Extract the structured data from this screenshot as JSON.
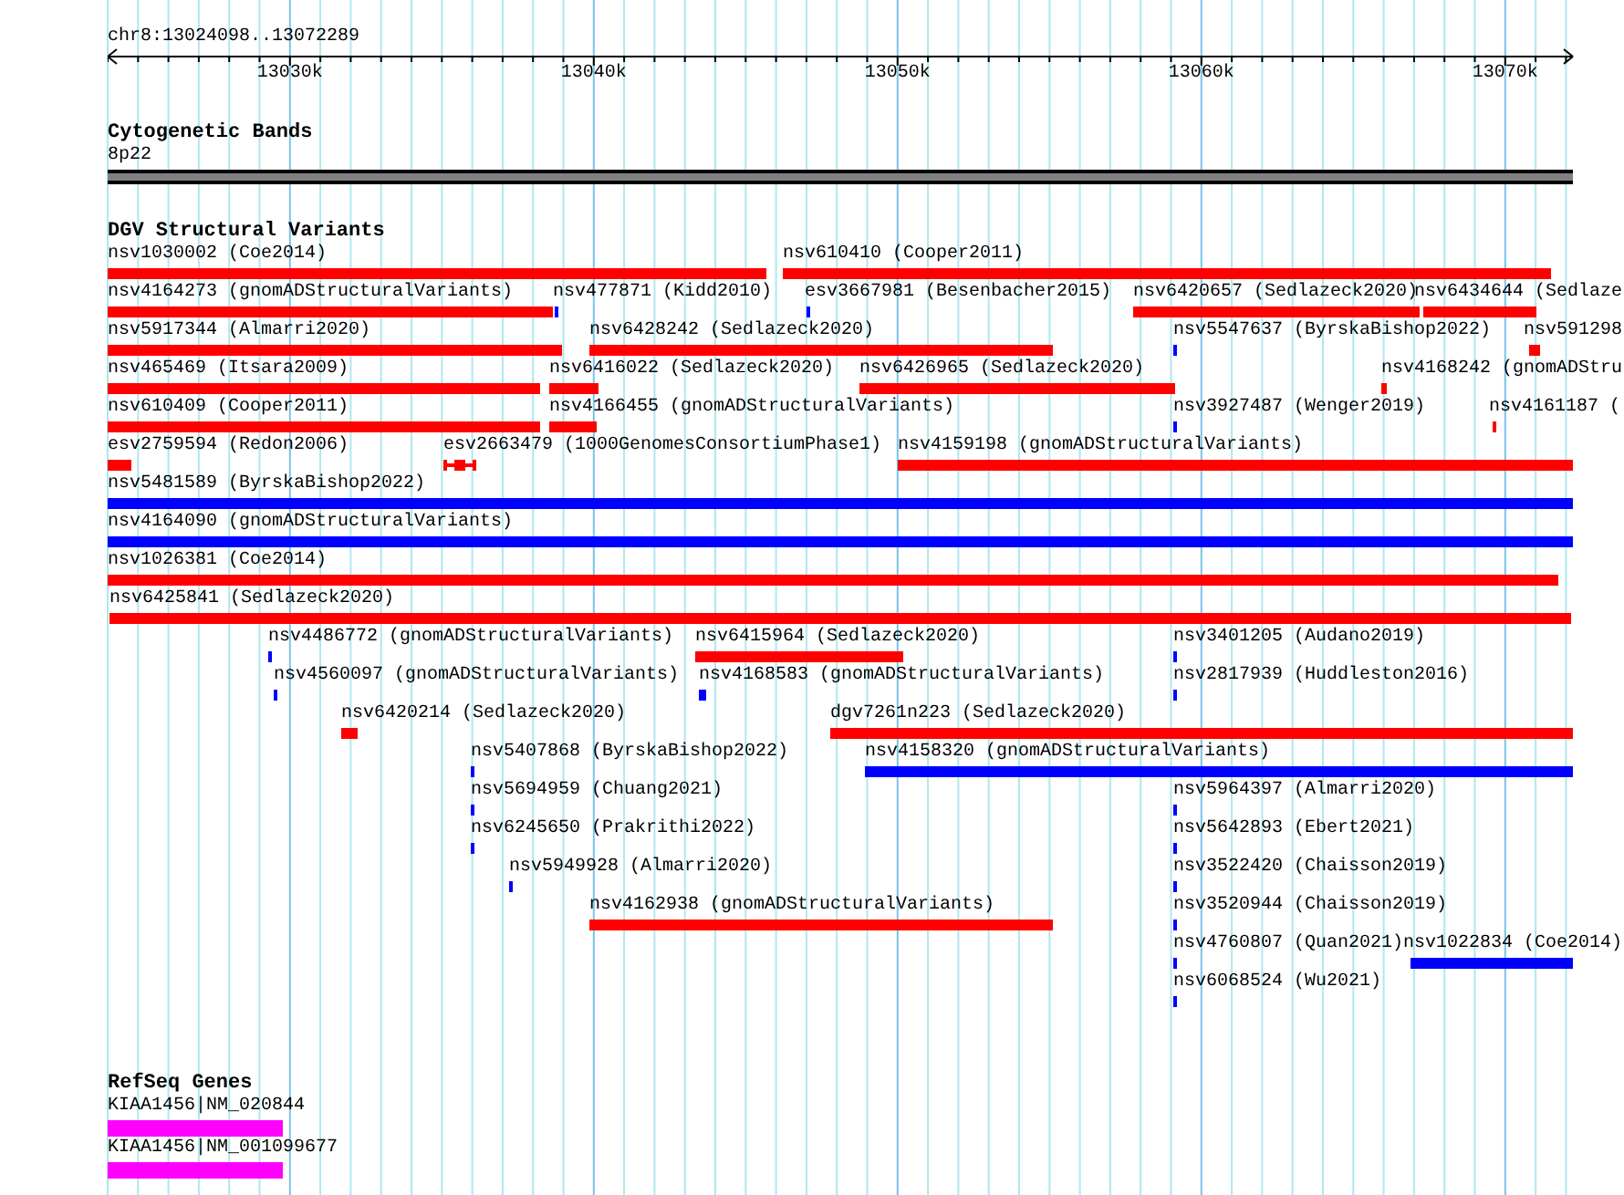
{
  "locus": "chr8:13024098..13072289",
  "ruler": {
    "ticks": [
      "13030k",
      "13040k",
      "13050k",
      "13060k",
      "13070k"
    ]
  },
  "cytoband_track": {
    "title": "Cytogenetic Bands",
    "band": {
      "label": "8p22"
    }
  },
  "variant_track": {
    "title": "DGV Structural Variants",
    "features": [
      {
        "label": "nsv1030002 (Coe2014)",
        "color": "#ff0000",
        "kind": "bar"
      },
      {
        "label": "nsv610410 (Cooper2011)",
        "color": "#ff0000",
        "kind": "bar"
      },
      {
        "label": "nsv4164273 (gnomADStructuralVariants)",
        "color": "#ff0000",
        "kind": "bar"
      },
      {
        "label": "nsv477871 (Kidd2010)",
        "color": "#0000ff",
        "kind": "bar"
      },
      {
        "label": "esv3667981 (Besenbacher2015)",
        "color": "#0000ff",
        "kind": "bar"
      },
      {
        "label": "nsv6420657 (Sedlazeck2020)",
        "color": "#ff0000",
        "kind": "bar"
      },
      {
        "label": "nsv6434644 (Sedlaze",
        "color": "#ff0000",
        "kind": "bar"
      },
      {
        "label": "nsv5917344 (Almarri2020)",
        "color": "#ff0000",
        "kind": "bar"
      },
      {
        "label": "nsv6428242 (Sedlazeck2020)",
        "color": "#ff0000",
        "kind": "bar"
      },
      {
        "label": "nsv5547637 (ByrskaBishop2022)",
        "color": "#0000ff",
        "kind": "bar"
      },
      {
        "label": "nsv591298",
        "color": "#ff0000",
        "kind": "bar"
      },
      {
        "label": "nsv465469 (Itsara2009)",
        "color": "#ff0000",
        "kind": "bar"
      },
      {
        "label": "nsv6416022 (Sedlazeck2020)",
        "color": "#ff0000",
        "kind": "bar"
      },
      {
        "label": "nsv6426965 (Sedlazeck2020)",
        "color": "#ff0000",
        "kind": "bar"
      },
      {
        "label": "nsv4168242 (gnomADStru",
        "color": "#ff0000",
        "kind": "bar"
      },
      {
        "label": "nsv610409 (Cooper2011)",
        "color": "#ff0000",
        "kind": "bar"
      },
      {
        "label": "nsv4166455 (gnomADStructuralVariants)",
        "color": "#ff0000",
        "kind": "bar"
      },
      {
        "label": "nsv3927487 (Wenger2019)",
        "color": "#0000ff",
        "kind": "bar"
      },
      {
        "label": "nsv4161187 (",
        "color": "#ff0000",
        "kind": "bar"
      },
      {
        "label": "esv2759594 (Redon2006)",
        "color": "#ff0000",
        "kind": "bar"
      },
      {
        "label": "esv2663479 (1000GenomesConsortiumPhase1)",
        "color": "#ff0000",
        "kind": "linked"
      },
      {
        "label": "nsv4159198 (gnomADStructuralVariants)",
        "color": "#ff0000",
        "kind": "bar"
      },
      {
        "label": "nsv5481589 (ByrskaBishop2022)",
        "color": "#0000ff",
        "kind": "bar"
      },
      {
        "label": "nsv4164090 (gnomADStructuralVariants)",
        "color": "#0000ff",
        "kind": "bar"
      },
      {
        "label": "nsv1026381 (Coe2014)",
        "color": "#ff0000",
        "kind": "bar"
      },
      {
        "label": "nsv6425841 (Sedlazeck2020)",
        "color": "#ff0000",
        "kind": "bar"
      },
      {
        "label": "nsv4486772 (gnomADStructuralVariants)",
        "color": "#0000ff",
        "kind": "bar"
      },
      {
        "label": "nsv6415964 (Sedlazeck2020)",
        "color": "#ff0000",
        "kind": "bar"
      },
      {
        "label": "nsv3401205 (Audano2019)",
        "color": "#0000ff",
        "kind": "bar"
      },
      {
        "label": "nsv4560097 (gnomADStructuralVariants)",
        "color": "#0000ff",
        "kind": "bar"
      },
      {
        "label": "nsv4168583 (gnomADStructuralVariants)",
        "color": "#0000ff",
        "kind": "bar"
      },
      {
        "label": "nsv2817939 (Huddleston2016)",
        "color": "#0000ff",
        "kind": "bar"
      },
      {
        "label": "nsv6420214 (Sedlazeck2020)",
        "color": "#ff0000",
        "kind": "bar"
      },
      {
        "label": "dgv7261n223 (Sedlazeck2020)",
        "color": "#ff0000",
        "kind": "bar"
      },
      {
        "label": "nsv5407868 (ByrskaBishop2022)",
        "color": "#0000ff",
        "kind": "bar"
      },
      {
        "label": "nsv4158320 (gnomADStructuralVariants)",
        "color": "#0000ff",
        "kind": "bar"
      },
      {
        "label": "nsv5694959 (Chuang2021)",
        "color": "#0000ff",
        "kind": "bar"
      },
      {
        "label": "nsv5964397 (Almarri2020)",
        "color": "#0000ff",
        "kind": "bar"
      },
      {
        "label": "nsv6245650 (Prakrithi2022)",
        "color": "#0000ff",
        "kind": "bar"
      },
      {
        "label": "nsv5642893 (Ebert2021)",
        "color": "#0000ff",
        "kind": "bar"
      },
      {
        "label": "nsv5949928 (Almarri2020)",
        "color": "#0000ff",
        "kind": "bar"
      },
      {
        "label": "nsv3522420 (Chaisson2019)",
        "color": "#0000ff",
        "kind": "bar"
      },
      {
        "label": "nsv4162938 (gnomADStructuralVariants)",
        "color": "#ff0000",
        "kind": "bar"
      },
      {
        "label": "nsv3520944 (Chaisson2019)",
        "color": "#0000ff",
        "kind": "bar"
      },
      {
        "label": "nsv4760807 (Quan2021)",
        "color": "#0000ff",
        "kind": "bar"
      },
      {
        "label": "nsv1022834 (Coe2014)",
        "color": "#0000ff",
        "kind": "bar"
      },
      {
        "label": "nsv6068524 (Wu2021)",
        "color": "#0000ff",
        "kind": "bar"
      }
    ]
  },
  "gene_track": {
    "title": "RefSeq Genes",
    "features": [
      {
        "label": "KIAA1456|NM_020844",
        "color": "#ff00ff"
      },
      {
        "label": "KIAA1456|NM_001099677",
        "color": "#ff00ff"
      }
    ]
  }
}
